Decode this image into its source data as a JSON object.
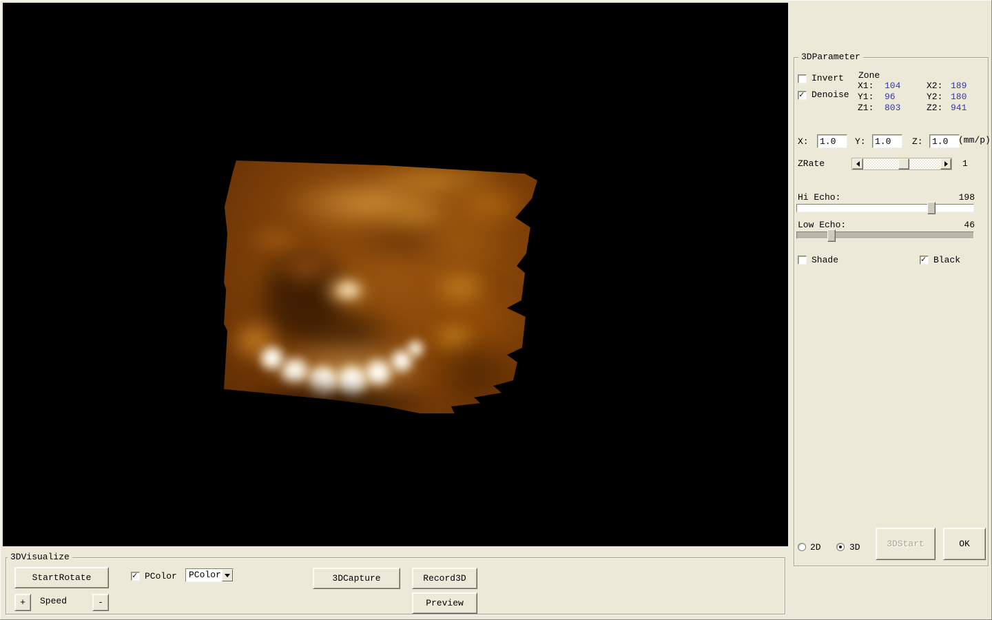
{
  "viewport": {
    "description": "3D ultrasound volume render"
  },
  "parameter_panel": {
    "title": "3DParameter",
    "invert": {
      "label": "Invert",
      "checked": false
    },
    "denoise": {
      "label": "Denoise",
      "checked": true
    },
    "zone": {
      "title": "Zone",
      "x1_label": "X1:",
      "x1": "104",
      "x2_label": "X2:",
      "x2": "189",
      "y1_label": "Y1:",
      "y1": "96",
      "y2_label": "Y2:",
      "y2": "180",
      "z1_label": "Z1:",
      "z1": "803",
      "z2_label": "Z2:",
      "z2": "941"
    },
    "scale": {
      "x_label": "X:",
      "x": "1.0",
      "y_label": "Y:",
      "y": "1.0",
      "z_label": "Z:",
      "z": "1.0",
      "unit": "(mm/p)"
    },
    "zrate": {
      "label": "ZRate",
      "value": "1"
    },
    "hi_echo": {
      "label": "Hi Echo:",
      "value": 198,
      "max": 255
    },
    "low_echo": {
      "label": "Low Echo:",
      "value": 46,
      "max": 255
    },
    "shade": {
      "label": "Shade",
      "checked": false
    },
    "black": {
      "label": "Black",
      "checked": true
    },
    "mode": {
      "radio_2d": {
        "label": "2D",
        "selected": false
      },
      "radio_3d": {
        "label": "3D",
        "selected": true
      }
    },
    "start3d_button": {
      "label": "3DStart",
      "enabled": false
    },
    "ok_button": {
      "label": "OK"
    }
  },
  "visualize_panel": {
    "title": "3DVisualize",
    "start_rotate_button": "StartRotate",
    "pcolor_checkbox": {
      "label": "PColor",
      "checked": true
    },
    "pcolor_select": {
      "value": "PColor"
    },
    "capture_button": "3DCapture",
    "record_button": "Record3D",
    "preview_button": "Preview",
    "speed": {
      "label": "Speed",
      "plus": "+",
      "minus": "-"
    }
  },
  "colors": {
    "panel_background": "#ece9d8",
    "viewport_background": "#000000",
    "zone_value_text": "#3434bc",
    "volume_base": "#7e4008",
    "volume_highlight": "#fffdf6"
  }
}
